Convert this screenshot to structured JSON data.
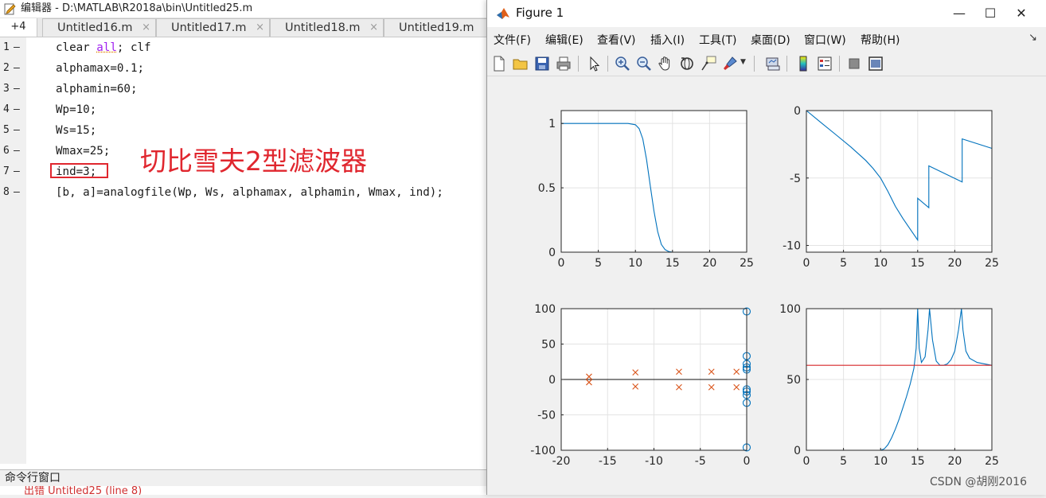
{
  "editor": {
    "title": "编辑器 - D:\\MATLAB\\R2018a\\bin\\Untitled25.m",
    "plus_tab": "+4",
    "tabs": [
      "Untitled16.m",
      "Untitled17.m",
      "Untitled18.m",
      "Untitled19.m"
    ],
    "tab_close": "×",
    "line_numbers": [
      "1",
      "2",
      "3",
      "4",
      "5",
      "6",
      "7",
      "8"
    ],
    "line_marker": "—",
    "code": {
      "l1_a": "clear ",
      "l1_kw": "all",
      "l1_b": "; clf",
      "l2": "alphamax=0.1;",
      "l3": "alphamin=60;",
      "l4": "Wp=10;",
      "l5": "Ws=15;",
      "l6": "Wmax=25;",
      "l7": "ind=3;",
      "l8": "[b, a]=analogfile(Wp, Ws, alphamax, alphamin, Wmax, ind);"
    },
    "annotation": "切比雪夫2型滤波器",
    "command_window": {
      "header": "命令行窗口",
      "partial_line": "出错 Untitled25 (line 8)"
    }
  },
  "figure": {
    "title": "Figure 1",
    "window_controls": {
      "minimize": "—",
      "maximize": "☐",
      "close": "✕"
    },
    "menus": [
      "文件(F)",
      "编辑(E)",
      "查看(V)",
      "插入(I)",
      "工具(T)",
      "桌面(D)",
      "窗口(W)",
      "帮助(H)"
    ],
    "menu_overflow": "↘",
    "toolbar_icons": [
      "new-file-icon",
      "open-folder-icon",
      "save-icon",
      "print-icon",
      "select-arrow-icon",
      "zoom-in-icon",
      "zoom-out-icon",
      "pan-hand-icon",
      "rotate-3d-icon",
      "data-cursor-icon",
      "brush-icon",
      "link-plot-icon",
      "colorbar-icon",
      "legend-icon",
      "hide-plot-tools-icon",
      "show-plot-tools-icon"
    ]
  },
  "chart_data": [
    {
      "type": "line",
      "xlim": [
        0,
        25
      ],
      "ylim": [
        0,
        1.1
      ],
      "xticks": [
        0,
        5,
        10,
        15,
        20,
        25
      ],
      "yticks": [
        0,
        0.5,
        1
      ],
      "ytick_labels": [
        "0",
        "0.5",
        "1"
      ],
      "grid": true,
      "series": [
        {
          "color": "#0072bd",
          "x": [
            0,
            9,
            10,
            10.5,
            11,
            11.5,
            12,
            12.5,
            13,
            13.5,
            14,
            14.5,
            15,
            25
          ],
          "y": [
            1,
            1,
            0.99,
            0.96,
            0.88,
            0.72,
            0.52,
            0.32,
            0.16,
            0.06,
            0.02,
            0.005,
            0,
            0
          ]
        }
      ]
    },
    {
      "type": "line",
      "xlim": [
        0,
        25
      ],
      "ylim": [
        -10.5,
        0
      ],
      "xticks": [
        0,
        5,
        10,
        15,
        20,
        25
      ],
      "yticks": [
        -10,
        -5,
        0
      ],
      "ytick_labels": [
        "-10",
        "-5",
        "0"
      ],
      "grid": true,
      "series": [
        {
          "color": "#0072bd",
          "x": [
            0,
            2,
            4,
            6,
            8,
            9,
            10,
            11,
            12,
            13,
            14,
            15,
            15,
            16.5,
            16.5,
            21,
            21,
            25
          ],
          "y": [
            0,
            -0.9,
            -1.8,
            -2.7,
            -3.7,
            -4.3,
            -5.0,
            -6.0,
            -7.1,
            -8.0,
            -8.8,
            -9.6,
            -6.5,
            -7.2,
            -4.1,
            -5.3,
            -2.1,
            -2.8
          ]
        }
      ]
    },
    {
      "type": "scatter",
      "xlim": [
        -20,
        0
      ],
      "ylim": [
        -100,
        100
      ],
      "xticks": [
        -20,
        -15,
        -10,
        -5,
        0
      ],
      "yticks": [
        -100,
        -50,
        0,
        50,
        100
      ],
      "ytick_labels": [
        "-100",
        "-50",
        "0",
        "50",
        "100"
      ],
      "grid": true,
      "zero_line": true,
      "poles_x": [
        [
          -17,
          4
        ],
        [
          -17,
          -4
        ],
        [
          -12,
          10
        ],
        [
          -12,
          -10
        ],
        [
          -7.3,
          11
        ],
        [
          -7.3,
          -11
        ],
        [
          -3.8,
          11
        ],
        [
          -3.8,
          -11
        ],
        [
          -1.1,
          11
        ],
        [
          -1.1,
          -11
        ]
      ],
      "zeros_o": [
        [
          0,
          96
        ],
        [
          0,
          33
        ],
        [
          0,
          22
        ],
        [
          0,
          17
        ],
        [
          0,
          14
        ],
        [
          0,
          -14
        ],
        [
          0,
          -17
        ],
        [
          0,
          -22
        ],
        [
          0,
          -33
        ],
        [
          0,
          -96
        ]
      ],
      "pole_color": "#d95319",
      "zero_color": "#0072bd"
    },
    {
      "type": "line",
      "xlim": [
        0,
        25
      ],
      "ylim": [
        0,
        100
      ],
      "xticks": [
        0,
        5,
        10,
        15,
        20,
        25
      ],
      "yticks": [
        0,
        50,
        100
      ],
      "ytick_labels": [
        "0",
        "50",
        "100"
      ],
      "grid": true,
      "series": [
        {
          "color": "#0072bd",
          "x": [
            0,
            10,
            10.5,
            11,
            11.5,
            12,
            12.5,
            13,
            13.5,
            14,
            14.5,
            14.8,
            15,
            15.2,
            15.5,
            16,
            16.4,
            16.6,
            17,
            17.5,
            18,
            18.5,
            19,
            19.5,
            20,
            20.5,
            20.9,
            21.1,
            21.5,
            22,
            23,
            24,
            25
          ],
          "y": [
            0,
            0,
            1,
            4,
            9,
            15,
            22,
            30,
            38,
            47,
            58,
            72,
            100,
            72,
            62,
            66,
            85,
            100,
            78,
            63,
            60,
            60,
            61,
            64,
            70,
            85,
            100,
            85,
            70,
            65,
            62,
            61,
            60
          ]
        },
        {
          "color": "#d62728",
          "x": [
            0,
            25
          ],
          "y": [
            60,
            60
          ]
        },
        {
          "color": "#d62728",
          "x": [
            0,
            25
          ],
          "y": [
            0,
            0
          ]
        }
      ]
    }
  ],
  "tick_text": {
    "x_0_25": [
      "0",
      "5",
      "10",
      "15",
      "20",
      "25"
    ],
    "x_neg20_0": [
      "-20",
      "-15",
      "-10",
      "-5",
      "0"
    ]
  },
  "watermark": "CSDN @胡刚2016"
}
